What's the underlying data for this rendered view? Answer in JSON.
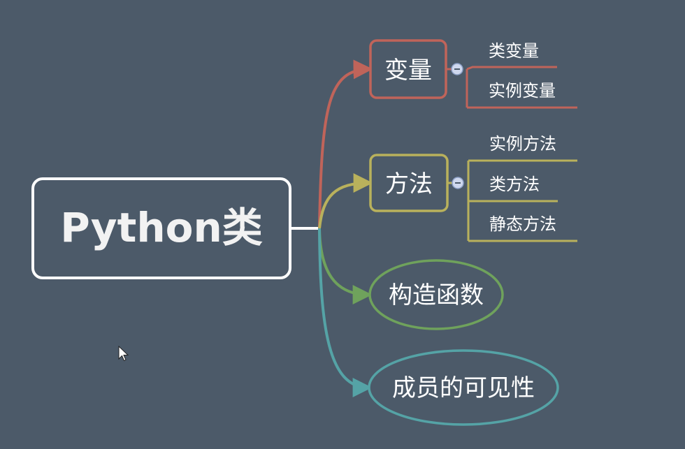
{
  "mindmap": {
    "root": {
      "label": "Python类",
      "color": "#ffffff"
    },
    "background": "#4c5a69",
    "branches": [
      {
        "id": "variables",
        "label": "变量",
        "color": "#c0645a",
        "shape": "rounded-rect",
        "collapse_icon": "minus-icon",
        "children": [
          "类变量",
          "实例变量"
        ]
      },
      {
        "id": "methods",
        "label": "方法",
        "color": "#b9b15c",
        "shape": "rounded-rect",
        "collapse_icon": "minus-icon",
        "children": [
          "实例方法",
          "类方法",
          "静态方法"
        ]
      },
      {
        "id": "constructor",
        "label": "构造函数",
        "color": "#6fa25c",
        "shape": "ellipse",
        "children": []
      },
      {
        "id": "visibility",
        "label": "成员的可见性",
        "color": "#55a3a6",
        "shape": "ellipse",
        "children": []
      }
    ]
  }
}
